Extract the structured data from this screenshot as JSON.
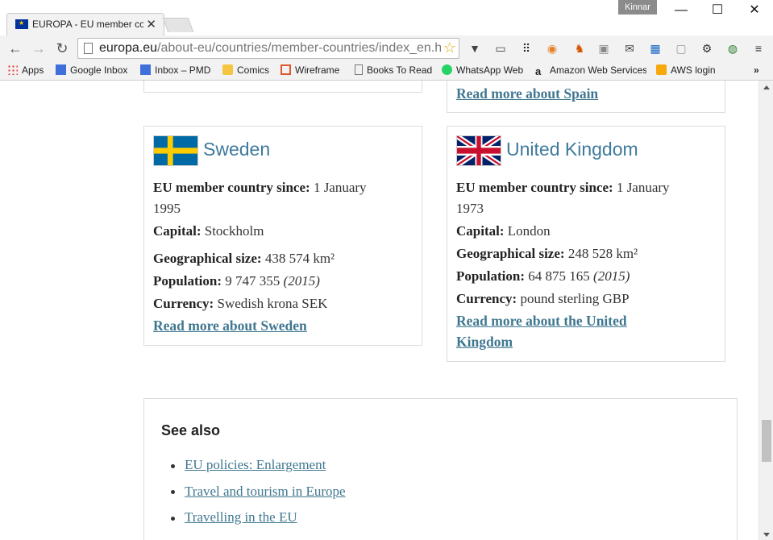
{
  "window": {
    "tab_title": "EUROPA - EU member cou",
    "profile_name": "Kinnar"
  },
  "toolbar": {
    "url_host": "europa.eu",
    "url_path": "/about-eu/countries/member-countries/index_en.h"
  },
  "bookmarks": [
    {
      "label": "Apps",
      "icon": "apps-grid-icon"
    },
    {
      "label": "Google Inbox",
      "icon": "inbox-icon"
    },
    {
      "label": "Inbox – PMD",
      "icon": "inbox-icon"
    },
    {
      "label": "Comics",
      "icon": "folder-icon"
    },
    {
      "label": "Wireframe",
      "icon": "wireframe-icon"
    },
    {
      "label": "Books To Read",
      "icon": "page-icon"
    },
    {
      "label": "WhatsApp Web",
      "icon": "whatsapp-icon"
    },
    {
      "label": "Amazon Web Services",
      "icon": "amazon-icon"
    },
    {
      "label": "AWS login",
      "icon": "aws-icon"
    }
  ],
  "spain_card": {
    "read_more": "Read more about Spain"
  },
  "countries": [
    {
      "name": "Sweden",
      "since_label": "EU member country since:",
      "since_value_line1": " 1 January",
      "since_value_line2": "1995",
      "capital_label": "Capital:",
      "capital_value": " Stockholm",
      "size_label": "Geographical size:",
      "size_value": " 438 574 km²",
      "population_label": "Population:",
      "population_value": " 9 747 355 ",
      "population_year": "(2015)",
      "currency_label": "Currency:",
      "currency_value": " Swedish krona SEK",
      "read_more_line1": "Read more about Sweden",
      "read_more_line2": ""
    },
    {
      "name": "United Kingdom",
      "since_label": "EU member country since:",
      "since_value_line1": " 1 January",
      "since_value_line2": "1973",
      "capital_label": "Capital:",
      "capital_value": " London",
      "size_label": "Geographical size:",
      "size_value": " 248 528 km²",
      "population_label": "Population:",
      "population_value": " 64 875 165 ",
      "population_year": "(2015)",
      "currency_label": "Currency:",
      "currency_value": " pound sterling GBP",
      "read_more_line1": "Read more about the United",
      "read_more_line2": "Kingdom"
    }
  ],
  "see_also": {
    "title": "See also",
    "items": [
      "EU policies: Enlargement",
      "Travel and tourism in Europe",
      "Travelling in the EU"
    ]
  },
  "colors": {
    "link": "#3f7790",
    "heading": "#3e7a9c",
    "sweden_blue": "#006aa7",
    "sweden_yellow": "#fecc00",
    "uk_blue": "#012169",
    "uk_red": "#c8102e"
  }
}
